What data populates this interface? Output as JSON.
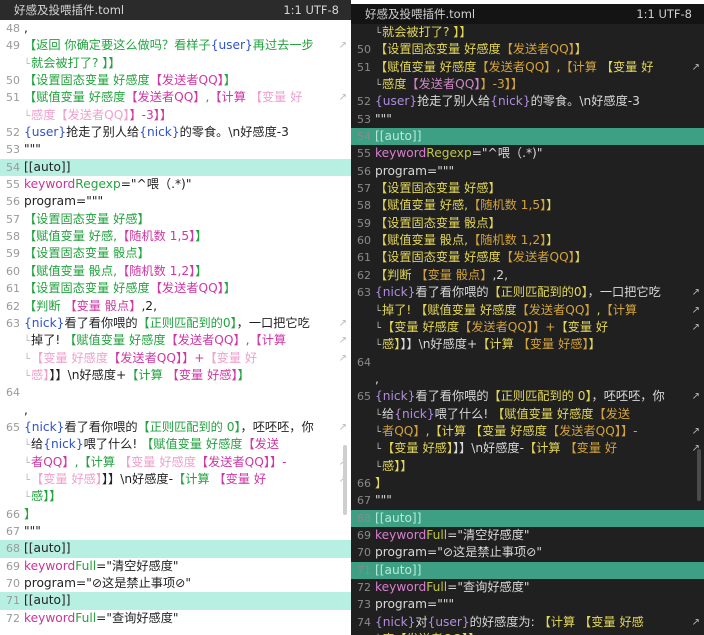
{
  "left": {
    "title": "好感及投喂插件.toml",
    "status": "1:1  UTF-8",
    "lines": [
      {
        "n": "48",
        "hl": false,
        "parts": [
          {
            "t": ","
          }
        ]
      },
      {
        "n": "49",
        "hl": false,
        "wrap": true,
        "parts": [
          {
            "t": "【返回 你确定要这么做吗？看样子",
            "c": "g"
          },
          {
            "t": "{user}",
            "c": "v"
          },
          {
            "t": "再过去一步",
            "c": "g"
          }
        ]
      },
      {
        "n": "",
        "hl": false,
        "cont": true,
        "parts": [
          {
            "t": "就会被打了? 】】",
            "c": "g"
          }
        ]
      },
      {
        "n": "50",
        "hl": false,
        "parts": [
          {
            "t": "【设置固态变量 好感度",
            "c": "g"
          },
          {
            "t": "【发送者QQ】",
            "c": "c"
          },
          {
            "t": "】",
            "c": "g"
          }
        ]
      },
      {
        "n": "51",
        "hl": false,
        "wrap": true,
        "parts": [
          {
            "t": "【赋值变量 好感度",
            "c": "g"
          },
          {
            "t": "【发送者QQ】",
            "c": "c"
          },
          {
            "t": ",",
            "c": "g"
          },
          {
            "t": "【计算 ",
            "c": "c"
          },
          {
            "t": "【变量 好",
            "c": "p"
          }
        ]
      },
      {
        "n": "",
        "hl": false,
        "cont": true,
        "parts": [
          {
            "t": "感度",
            "c": "p"
          },
          {
            "t": "【发送者QQ】",
            "c": "p"
          },
          {
            "t": "】-3】】",
            "c": "c"
          }
        ]
      },
      {
        "n": "52",
        "hl": false,
        "parts": [
          {
            "t": "{user}",
            "c": "v"
          },
          {
            "t": "抢走了别人给"
          },
          {
            "t": "{nick}",
            "c": "v"
          },
          {
            "t": "的零食。\\n好感度-3"
          }
        ]
      },
      {
        "n": "53",
        "hl": false,
        "parts": [
          {
            "t": "\"\"\""
          }
        ]
      },
      {
        "n": "54",
        "hl": true,
        "parts": [
          {
            "t": "[[auto]]"
          }
        ]
      },
      {
        "n": "55",
        "hl": false,
        "parts": [
          {
            "t": "keyword",
            "c": "k"
          },
          {
            "t": "Regexp",
            "c": "g"
          },
          {
            "t": "=\"^喂（.*)\""
          }
        ]
      },
      {
        "n": "56",
        "hl": false,
        "parts": [
          {
            "t": "program=\"\"\""
          }
        ]
      },
      {
        "n": "57",
        "hl": false,
        "parts": [
          {
            "t": "【设置固态变量 好感】",
            "c": "g"
          }
        ]
      },
      {
        "n": "58",
        "hl": false,
        "parts": [
          {
            "t": "【赋值变量 好感,",
            "c": "g"
          },
          {
            "t": "【随机数 1,5】",
            "c": "c"
          },
          {
            "t": "】",
            "c": "g"
          }
        ]
      },
      {
        "n": "59",
        "hl": false,
        "parts": [
          {
            "t": "【设置固态变量 骰点】",
            "c": "g"
          }
        ]
      },
      {
        "n": "60",
        "hl": false,
        "parts": [
          {
            "t": "【赋值变量 骰点,",
            "c": "g"
          },
          {
            "t": "【随机数 1,2】",
            "c": "c"
          },
          {
            "t": "】",
            "c": "g"
          }
        ]
      },
      {
        "n": "61",
        "hl": false,
        "parts": [
          {
            "t": "【设置固态变量 好感度",
            "c": "g"
          },
          {
            "t": "【发送者QQ】",
            "c": "c"
          },
          {
            "t": "】",
            "c": "g"
          }
        ]
      },
      {
        "n": "62",
        "hl": false,
        "parts": [
          {
            "t": "【判断 ",
            "c": "g"
          },
          {
            "t": "【变量 骰点】",
            "c": "c"
          },
          {
            "t": ",2,"
          }
        ]
      },
      {
        "n": "63",
        "hl": false,
        "wrap": true,
        "parts": [
          {
            "t": "{nick}",
            "c": "v"
          },
          {
            "t": "看了看你喂的"
          },
          {
            "t": "【正则匹配到的0】",
            "c": "g"
          },
          {
            "t": "，一口把它吃"
          }
        ]
      },
      {
        "n": "",
        "hl": false,
        "cont": true,
        "wrap": true,
        "parts": [
          {
            "t": "掉了! "
          },
          {
            "t": "【赋值变量 好感度",
            "c": "g"
          },
          {
            "t": "【发送者QQ】",
            "c": "c"
          },
          {
            "t": ",",
            "c": "g"
          },
          {
            "t": "【计算",
            "c": "c"
          }
        ]
      },
      {
        "n": "",
        "hl": false,
        "cont": true,
        "wrap": true,
        "parts": [
          {
            "t": "【变量 好感度",
            "c": "p"
          },
          {
            "t": "【发送者QQ】",
            "c": "c"
          },
          {
            "t": "】+",
            "c": "c"
          },
          {
            "t": "【变量 好",
            "c": "p"
          }
        ]
      },
      {
        "n": "",
        "hl": false,
        "cont": true,
        "parts": [
          {
            "t": "感】",
            "c": "p"
          },
          {
            "t": "】】\\n好感度+"
          },
          {
            "t": "【计算 ",
            "c": "g"
          },
          {
            "t": "【变量 好感】",
            "c": "c"
          },
          {
            "t": "】",
            "c": "g"
          }
        ]
      },
      {
        "n": "64",
        "hl": false,
        "parts": [
          {
            "t": ""
          }
        ]
      },
      {
        "n": "",
        "hl": false,
        "parts": [
          {
            "t": ","
          }
        ]
      },
      {
        "n": "65",
        "hl": false,
        "wrap": true,
        "parts": [
          {
            "t": "{nick}",
            "c": "v"
          },
          {
            "t": "看了看你喂的"
          },
          {
            "t": "【正则匹配到的 0】",
            "c": "g"
          },
          {
            "t": "，呸呸呸，你"
          }
        ]
      },
      {
        "n": "",
        "hl": false,
        "cont": true,
        "parts": [
          {
            "t": "给"
          },
          {
            "t": "{nick}",
            "c": "v"
          },
          {
            "t": "喂了什么! "
          },
          {
            "t": "【赋值变量 好感度",
            "c": "g"
          },
          {
            "t": "【发送",
            "c": "c"
          }
        ]
      },
      {
        "n": "",
        "hl": false,
        "cont": true,
        "wrap": true,
        "parts": [
          {
            "t": "者QQ】",
            "c": "c"
          },
          {
            "t": ",",
            "c": "g"
          },
          {
            "t": "【计算 ",
            "c": "g"
          },
          {
            "t": "【变量 好感度",
            "c": "p"
          },
          {
            "t": "【发送者QQ】",
            "c": "c"
          },
          {
            "t": "】-",
            "c": "c"
          }
        ]
      },
      {
        "n": "",
        "hl": false,
        "cont": true,
        "wrap": true,
        "parts": [
          {
            "t": "【变量 好感】",
            "c": "p"
          },
          {
            "t": "】】\\n好感度-"
          },
          {
            "t": "【计算 ",
            "c": "g"
          },
          {
            "t": "【变量 好",
            "c": "c"
          }
        ]
      },
      {
        "n": "",
        "hl": false,
        "cont": true,
        "parts": [
          {
            "t": "感】】",
            "c": "g"
          }
        ]
      },
      {
        "n": "66",
        "hl": false,
        "parts": [
          {
            "t": "】",
            "c": "g"
          }
        ]
      },
      {
        "n": "67",
        "hl": false,
        "parts": [
          {
            "t": "\"\"\""
          }
        ]
      },
      {
        "n": "68",
        "hl": true,
        "parts": [
          {
            "t": "[[auto]]"
          }
        ]
      },
      {
        "n": "69",
        "hl": false,
        "parts": [
          {
            "t": "keyword",
            "c": "k"
          },
          {
            "t": "Full",
            "c": "g"
          },
          {
            "t": "=\"清空好感度\""
          }
        ]
      },
      {
        "n": "70",
        "hl": false,
        "parts": [
          {
            "t": "program=\"⊘这是禁止事项⊘\""
          }
        ]
      },
      {
        "n": "71",
        "hl": true,
        "parts": [
          {
            "t": "[[auto]]"
          }
        ]
      },
      {
        "n": "72",
        "hl": false,
        "parts": [
          {
            "t": "keyword",
            "c": "k"
          },
          {
            "t": "Full",
            "c": "g"
          },
          {
            "t": "=\"查询好感度\""
          }
        ]
      }
    ]
  },
  "right": {
    "title": "好感及投喂插件.toml",
    "status": "1:1  UTF-8",
    "lines": [
      {
        "n": "",
        "hl": false,
        "cont": true,
        "parts": [
          {
            "t": "就会被打了? 】】",
            "c": "o"
          }
        ]
      },
      {
        "n": "50",
        "hl": false,
        "parts": [
          {
            "t": "【设置固态变量 好感度",
            "c": "o"
          },
          {
            "t": "【发送者QQ】",
            "c": "c"
          },
          {
            "t": "】",
            "c": "o"
          }
        ]
      },
      {
        "n": "51",
        "hl": false,
        "wrap": true,
        "parts": [
          {
            "t": "【赋值变量 好感度",
            "c": "o"
          },
          {
            "t": "【发送者QQ】",
            "c": "c"
          },
          {
            "t": ",",
            "c": "o"
          },
          {
            "t": "【计算 ",
            "c": "c"
          },
          {
            "t": "【变量 好",
            "c": "o"
          }
        ]
      },
      {
        "n": "",
        "hl": false,
        "cont": true,
        "parts": [
          {
            "t": "感度",
            "c": "o"
          },
          {
            "t": "【发送者QQ】",
            "c": "p"
          },
          {
            "t": "】-3】】",
            "c": "c"
          }
        ]
      },
      {
        "n": "52",
        "hl": false,
        "parts": [
          {
            "t": "{user}",
            "c": "v"
          },
          {
            "t": "抢走了别人给"
          },
          {
            "t": "{nick}",
            "c": "v"
          },
          {
            "t": "的零食。\\n好感度-3"
          }
        ]
      },
      {
        "n": "53",
        "hl": false,
        "parts": [
          {
            "t": "\"\"\""
          }
        ]
      },
      {
        "n": "54",
        "hl": true,
        "parts": [
          {
            "t": "[[auto]]"
          }
        ]
      },
      {
        "n": "55",
        "hl": false,
        "parts": [
          {
            "t": "keyword",
            "c": "k"
          },
          {
            "t": "Regexp",
            "c": "g"
          },
          {
            "t": "=\"^喂（.*)\""
          }
        ]
      },
      {
        "n": "56",
        "hl": false,
        "parts": [
          {
            "t": "program=\"\"\""
          }
        ]
      },
      {
        "n": "57",
        "hl": false,
        "parts": [
          {
            "t": "【设置固态变量 好感】",
            "c": "o"
          }
        ]
      },
      {
        "n": "58",
        "hl": false,
        "parts": [
          {
            "t": "【赋值变量 好感,",
            "c": "o"
          },
          {
            "t": "【随机数 1,5】",
            "c": "c"
          },
          {
            "t": "】",
            "c": "o"
          }
        ]
      },
      {
        "n": "59",
        "hl": false,
        "parts": [
          {
            "t": "【设置固态变量 骰点】",
            "c": "o"
          }
        ]
      },
      {
        "n": "60",
        "hl": false,
        "parts": [
          {
            "t": "【赋值变量 骰点,",
            "c": "o"
          },
          {
            "t": "【随机数 1,2】",
            "c": "c"
          },
          {
            "t": "】",
            "c": "o"
          }
        ]
      },
      {
        "n": "61",
        "hl": false,
        "parts": [
          {
            "t": "【设置固态变量 好感度",
            "c": "o"
          },
          {
            "t": "【发送者QQ】",
            "c": "c"
          },
          {
            "t": "】",
            "c": "o"
          }
        ]
      },
      {
        "n": "62",
        "hl": false,
        "parts": [
          {
            "t": "【判断 ",
            "c": "o"
          },
          {
            "t": "【变量 骰点】",
            "c": "c"
          },
          {
            "t": ",2,"
          }
        ]
      },
      {
        "n": "63",
        "hl": false,
        "wrap": true,
        "parts": [
          {
            "t": "{nick}",
            "c": "v"
          },
          {
            "t": "看了看你喂的"
          },
          {
            "t": "【正则匹配到的0】",
            "c": "o"
          },
          {
            "t": "，一口把它吃"
          }
        ]
      },
      {
        "n": "",
        "hl": false,
        "cont": true,
        "wrap": true,
        "parts": [
          {
            "t": "掉了! ",
            "c": "o"
          },
          {
            "t": "【赋值变量 好感度",
            "c": "o"
          },
          {
            "t": "【发送者QQ】",
            "c": "c"
          },
          {
            "t": ",",
            "c": "o"
          },
          {
            "t": "【计算",
            "c": "c"
          }
        ]
      },
      {
        "n": "",
        "hl": false,
        "cont": true,
        "wrap": true,
        "parts": [
          {
            "t": "【变量 好感度",
            "c": "o"
          },
          {
            "t": "【发送者QQ】",
            "c": "c"
          },
          {
            "t": "】+",
            "c": "c"
          },
          {
            "t": "【变量 好",
            "c": "o"
          }
        ]
      },
      {
        "n": "",
        "hl": false,
        "cont": true,
        "parts": [
          {
            "t": "感】",
            "c": "o"
          },
          {
            "t": "】】\\n好感度+"
          },
          {
            "t": "【计算 ",
            "c": "o"
          },
          {
            "t": "【变量 好感】",
            "c": "c"
          },
          {
            "t": "】",
            "c": "o"
          }
        ]
      },
      {
        "n": "64",
        "hl": false,
        "parts": [
          {
            "t": ""
          }
        ]
      },
      {
        "n": "",
        "hl": false,
        "parts": [
          {
            "t": ","
          }
        ]
      },
      {
        "n": "65",
        "hl": false,
        "wrap": true,
        "parts": [
          {
            "t": "{nick}",
            "c": "v"
          },
          {
            "t": "看了看你喂的"
          },
          {
            "t": "【正则匹配到的 0】",
            "c": "o"
          },
          {
            "t": "，呸呸呸，你"
          }
        ]
      },
      {
        "n": "",
        "hl": false,
        "cont": true,
        "parts": [
          {
            "t": "给"
          },
          {
            "t": "{nick}",
            "c": "v"
          },
          {
            "t": "喂了什么! "
          },
          {
            "t": "【赋值变量 好感度",
            "c": "o"
          },
          {
            "t": "【发送",
            "c": "c"
          }
        ]
      },
      {
        "n": "",
        "hl": false,
        "cont": true,
        "wrap": true,
        "parts": [
          {
            "t": "者QQ】",
            "c": "c"
          },
          {
            "t": ",",
            "c": "o"
          },
          {
            "t": "【计算 ",
            "c": "o"
          },
          {
            "t": "【变量 好感度",
            "c": "o"
          },
          {
            "t": "【发送者QQ】",
            "c": "c"
          },
          {
            "t": "】-",
            "c": "c"
          }
        ]
      },
      {
        "n": "",
        "hl": false,
        "cont": true,
        "wrap": true,
        "parts": [
          {
            "t": "【变量 好感】",
            "c": "o"
          },
          {
            "t": "】】\\n好感度-"
          },
          {
            "t": "【计算 ",
            "c": "o"
          },
          {
            "t": "【变量 好",
            "c": "c"
          }
        ]
      },
      {
        "n": "",
        "hl": false,
        "cont": true,
        "parts": [
          {
            "t": "感】】",
            "c": "o"
          }
        ]
      },
      {
        "n": "66",
        "hl": false,
        "parts": [
          {
            "t": "】",
            "c": "o"
          }
        ]
      },
      {
        "n": "67",
        "hl": false,
        "parts": [
          {
            "t": "\"\"\""
          }
        ]
      },
      {
        "n": "68",
        "hl": true,
        "parts": [
          {
            "t": "[[auto]]"
          }
        ]
      },
      {
        "n": "69",
        "hl": false,
        "parts": [
          {
            "t": "keyword",
            "c": "k"
          },
          {
            "t": "Full",
            "c": "g"
          },
          {
            "t": "=\"清空好感度\""
          }
        ]
      },
      {
        "n": "70",
        "hl": false,
        "parts": [
          {
            "t": "program=\"⊘这是禁止事项⊘\""
          }
        ]
      },
      {
        "n": "71",
        "hl": true,
        "parts": [
          {
            "t": "[[auto]]"
          }
        ]
      },
      {
        "n": "72",
        "hl": false,
        "parts": [
          {
            "t": "keyword",
            "c": "k"
          },
          {
            "t": "Full",
            "c": "g"
          },
          {
            "t": "=\"查询好感度\""
          }
        ]
      },
      {
        "n": "73",
        "hl": false,
        "parts": [
          {
            "t": "program=\"\"\""
          }
        ]
      },
      {
        "n": "74",
        "hl": false,
        "wrap": true,
        "parts": [
          {
            "t": "{nick}",
            "c": "v"
          },
          {
            "t": "对"
          },
          {
            "t": "{user}",
            "c": "v"
          },
          {
            "t": "的好感度为: "
          },
          {
            "t": "【计算 ",
            "c": "o"
          },
          {
            "t": "【变量 好感",
            "c": "o"
          }
        ]
      },
      {
        "n": "",
        "hl": false,
        "cont": true,
        "parts": [
          {
            "t": "度【发送者QQ】】",
            "c": "o"
          }
        ]
      }
    ]
  },
  "colors": {
    "light_highlight": "#b7f0e2",
    "dark_highlight": "#3d9f84",
    "dark_background": "#202020"
  },
  "icons": {
    "wrap": "wrap-arrow-icon",
    "continuation": "continuation-arrow-icon"
  }
}
